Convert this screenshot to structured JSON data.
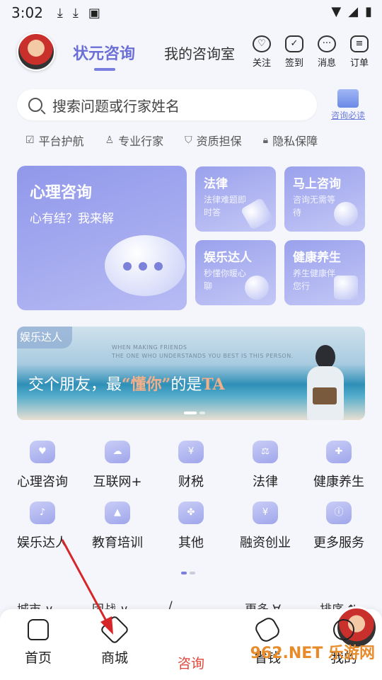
{
  "status_bar": {
    "time": "3:02"
  },
  "header": {
    "tab_active": "状元咨询",
    "tab_other": "我的咨询室",
    "icons": [
      {
        "label": "关注",
        "icon": "heart-icon"
      },
      {
        "label": "签到",
        "icon": "calendar-check-icon"
      },
      {
        "label": "消息",
        "icon": "chat-dots-icon"
      },
      {
        "label": "订单",
        "icon": "clipboard-icon"
      }
    ]
  },
  "search": {
    "placeholder": "搜索问题或行家姓名"
  },
  "must_read": {
    "label": "咨询必读"
  },
  "guarantees": [
    "平台护航",
    "专业行家",
    "资质担保",
    "隐私保障"
  ],
  "cards": {
    "big": {
      "title": "心理咨询",
      "subtitle": "心有结？我来解"
    },
    "law": {
      "title": "法律",
      "subtitle": "法律难题即时答"
    },
    "now": {
      "title": "马上咨询",
      "subtitle": "咨询无需等待"
    },
    "ent": {
      "title": "娱乐达人",
      "subtitle": "秒懂你暖心聊"
    },
    "health": {
      "title": "健康养生",
      "subtitle": "养生健康伴您行"
    }
  },
  "banner": {
    "tag": "娱乐达人",
    "eng_line1": "WHEN MAKING FRIENDS",
    "eng_line2": "THE ONE WHO UNDERSTANDS YOU BEST IS THIS PERSON.",
    "main_pre": "交个朋友，最",
    "main_hl": "“懂你”",
    "main_post": "的是",
    "main_end": "TA"
  },
  "categories": [
    "心理咨询",
    "互联网+",
    "财税",
    "法律",
    "健康养生",
    "娱乐达人",
    "教育培训",
    "其他",
    "融资创业",
    "更多服务"
  ],
  "filter": [
    "城市 ∨",
    "团战 ∨",
    "/",
    "更多 ∀",
    "排序 ⇅"
  ],
  "tabbar": {
    "home": "首页",
    "mall": "商城",
    "consult": "咨询",
    "save": "省钱",
    "mine": "我的"
  },
  "watermark": "962.NET 乐游网",
  "colors": {
    "accent": "#7a7ee0",
    "active_tab": "#e0463a",
    "arrow": "#d6262a"
  }
}
